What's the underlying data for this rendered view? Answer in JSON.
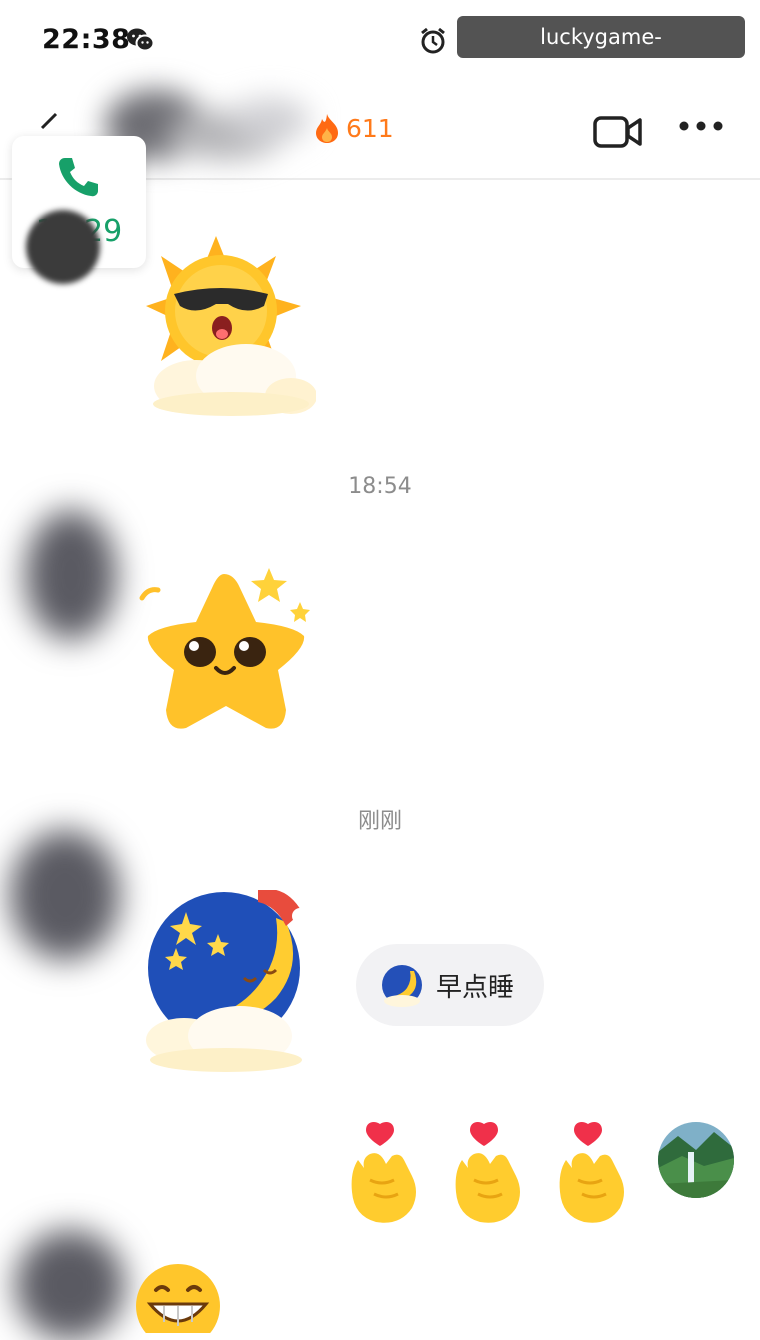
{
  "status_bar": {
    "time": "22:38"
  },
  "watermark": "luckygame-xingyun.com.cn",
  "header": {
    "streak_count": "611"
  },
  "call_record": {
    "time": "18:29"
  },
  "timestamps": [
    "18:54",
    "刚刚"
  ],
  "quick_reply": {
    "label": "早点睡"
  },
  "colors": {
    "call_green": "#17a069",
    "streak_orange": "#ff7a1a",
    "timestamp_gray": "#8c8c8c"
  }
}
